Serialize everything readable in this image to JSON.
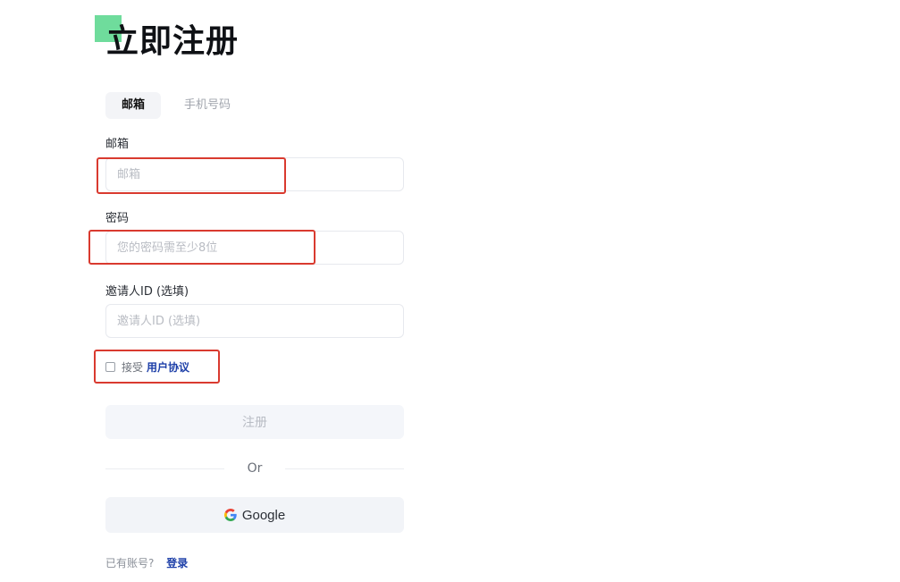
{
  "header": {
    "title": "立即注册"
  },
  "tabs": [
    {
      "label": "邮箱",
      "active": true
    },
    {
      "label": "手机号码",
      "active": false
    }
  ],
  "form": {
    "email": {
      "label": "邮箱",
      "placeholder": "邮箱",
      "value": ""
    },
    "password": {
      "label": "密码",
      "placeholder": "您的密码需至少8位",
      "value": ""
    },
    "inviter": {
      "label": "邀请人ID (选填)",
      "placeholder": "邀请人ID (选填)",
      "value": ""
    }
  },
  "agreement": {
    "checked": false,
    "text": "接受",
    "link_label": "用户协议"
  },
  "actions": {
    "register_label": "注册",
    "divider_text": "Or",
    "google_label": "Google",
    "google_icon": "google-g-icon"
  },
  "login": {
    "hint": "已有账号?",
    "link_label": "登录"
  },
  "colors": {
    "accent_green": "#6fdc9c",
    "highlight_red": "#d93a2f",
    "link_blue": "#1d3fa8"
  }
}
